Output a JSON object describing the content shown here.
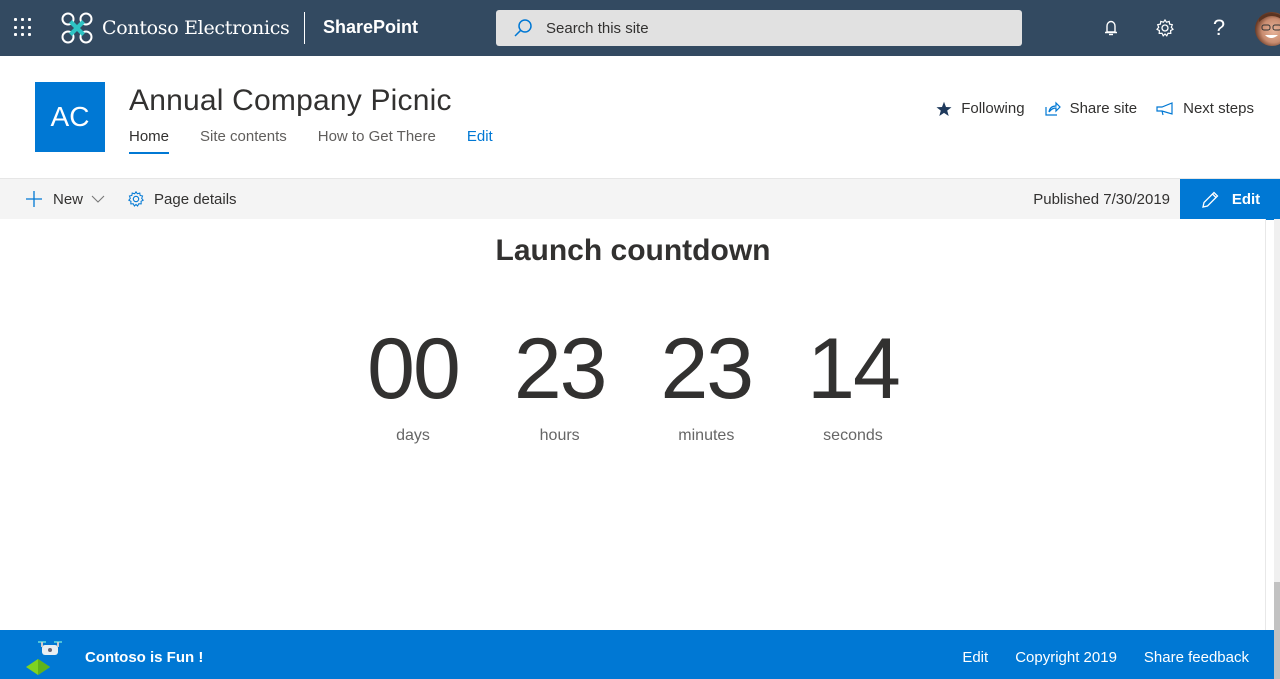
{
  "suite_bar": {
    "brand_name": "Contoso Electronics",
    "app_name": "SharePoint",
    "search_placeholder": "Search this site",
    "icons": [
      "app-launcher-icon",
      "notifications-icon",
      "settings-icon",
      "help-icon",
      "user-avatar"
    ]
  },
  "site_header": {
    "logo_initials": "AC",
    "logo_color": "#0078d4",
    "title": "Annual Company Picnic",
    "nav": [
      {
        "label": "Home",
        "active": true
      },
      {
        "label": "Site contents",
        "active": false
      },
      {
        "label": "How to Get There",
        "active": false
      },
      {
        "label": "Edit",
        "active": false
      }
    ],
    "actions": [
      {
        "label": "Following",
        "icon": "star-icon"
      },
      {
        "label": "Share site",
        "icon": "share-icon"
      },
      {
        "label": "Next steps",
        "icon": "megaphone-icon"
      }
    ]
  },
  "command_bar": {
    "new_label": "New",
    "page_details_label": "Page details",
    "published_label": "Published 7/30/2019",
    "edit_label": "Edit"
  },
  "countdown": {
    "title": "Launch countdown",
    "units": [
      {
        "value": "00",
        "label": "days"
      },
      {
        "value": "23",
        "label": "hours"
      },
      {
        "value": "23",
        "label": "minutes"
      },
      {
        "value": "14",
        "label": "seconds"
      }
    ]
  },
  "footer": {
    "name": "Contoso is Fun !",
    "links": [
      "Edit",
      "Copyright 2019",
      "Share feedback"
    ],
    "background": "#0078d4"
  }
}
